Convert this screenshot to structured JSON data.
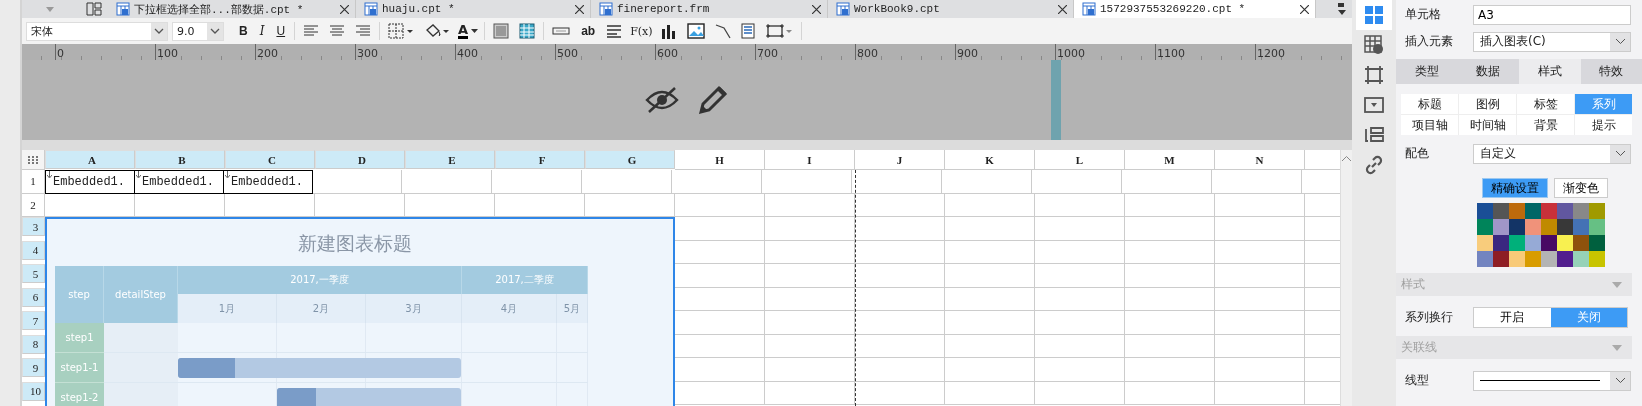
{
  "tabs": [
    {
      "label": "下拉框选择全部...部数据.cpt *",
      "selected": false
    },
    {
      "label": "huaju.cpt *",
      "selected": false
    },
    {
      "label": "finereport.frm",
      "selected": false
    },
    {
      "label": "WorkBook9.cpt",
      "selected": false
    },
    {
      "label": "1572937553269220.cpt *",
      "selected": true
    }
  ],
  "toolbar": {
    "font": "宋体",
    "size": "9.0",
    "style_buttons": [
      "B",
      "I",
      "U"
    ],
    "font_color": "A",
    "text_tools": [
      "ab",
      "F(x)"
    ]
  },
  "ruler": {
    "marks": [
      "0",
      "100",
      "200",
      "300",
      "400",
      "500",
      "600",
      "700",
      "800",
      "900",
      "1000",
      "1100",
      "1200"
    ]
  },
  "sheet": {
    "columns": [
      {
        "label": "A",
        "selected": true
      },
      {
        "label": "B",
        "selected": true
      },
      {
        "label": "C",
        "selected": true
      },
      {
        "label": "D",
        "selected": true
      },
      {
        "label": "E",
        "selected": true
      },
      {
        "label": "F",
        "selected": true
      },
      {
        "label": "G",
        "selected": true
      },
      {
        "label": "H",
        "selected": false
      },
      {
        "label": "I",
        "selected": false
      },
      {
        "label": "J",
        "selected": false
      },
      {
        "label": "K",
        "selected": false
      },
      {
        "label": "L",
        "selected": false
      },
      {
        "label": "M",
        "selected": false
      },
      {
        "label": "N",
        "selected": false
      }
    ],
    "rows": [
      {
        "label": "1",
        "selected": false,
        "cells": [
          "Embedded1.",
          "Embedded1.",
          "Embedded1."
        ]
      },
      {
        "label": "2",
        "selected": false,
        "cells": []
      },
      {
        "label": "3",
        "selected": true,
        "cells": []
      },
      {
        "label": "4",
        "selected": true,
        "cells": []
      },
      {
        "label": "5",
        "selected": true,
        "cells": []
      },
      {
        "label": "6",
        "selected": true,
        "cells": []
      },
      {
        "label": "7",
        "selected": true,
        "cells": []
      },
      {
        "label": "8",
        "selected": true,
        "cells": []
      },
      {
        "label": "9",
        "selected": true,
        "cells": []
      },
      {
        "label": "10",
        "selected": true,
        "cells": []
      }
    ]
  },
  "chart": {
    "title": "新建图表标题",
    "columns": [
      "step",
      "detailStep"
    ],
    "quarters": [
      {
        "label": "2017,一季度",
        "months": [
          "1月",
          "2月",
          "3月"
        ]
      },
      {
        "label": "2017,二季度",
        "months": [
          "4月",
          "5月"
        ]
      }
    ],
    "rows": [
      {
        "step": "step1",
        "months": [
          {
            "in_bar": false
          },
          {
            "in_bar": false
          },
          {
            "in_bar": false
          },
          {
            "in_bar": false
          },
          {
            "in_bar": false
          }
        ]
      },
      {
        "step": "step1-1",
        "months": [
          {
            "in_bar": true,
            "progress": {
              "level": 0.58
            }
          },
          {
            "in_bar": true
          },
          {
            "in_bar": true
          },
          {
            "in_bar": false
          },
          {
            "in_bar": false
          }
        ]
      },
      {
        "step": "step1-2",
        "months": [
          {
            "in_bar": false
          },
          {
            "in_bar": true,
            "progress": {
              "level": 0.44
            }
          },
          {
            "in_bar": true
          },
          {
            "in_bar": false
          },
          {
            "in_bar": false
          }
        ]
      }
    ]
  },
  "side_icons": [
    {
      "selected": true
    },
    {
      "selected": false
    },
    {
      "selected": false
    },
    {
      "selected": false
    },
    {
      "selected": false
    },
    {
      "selected": false
    }
  ],
  "panel": {
    "cell_label": "单元格",
    "cell_value": "A3",
    "insert_label": "插入元素",
    "insert_value": "插入图表(C)",
    "tabs": [
      {
        "label": "类型",
        "selected": false
      },
      {
        "label": "数据",
        "selected": false
      },
      {
        "label": "样式",
        "selected": true
      },
      {
        "label": "特效",
        "selected": false
      }
    ],
    "subtabs": [
      {
        "label": "标题",
        "selected": false
      },
      {
        "label": "图例",
        "selected": false
      },
      {
        "label": "标签",
        "selected": false
      },
      {
        "label": "系列",
        "selected": true
      },
      {
        "label": "项目轴",
        "selected": false
      },
      {
        "label": "时间轴",
        "selected": false
      },
      {
        "label": "背景",
        "selected": false
      },
      {
        "label": "提示",
        "selected": false
      }
    ],
    "scheme_label": "配色",
    "scheme_value": "自定义",
    "modes": [
      {
        "label": "精确设置",
        "selected": true
      },
      {
        "label": "渐变色",
        "selected": false
      }
    ],
    "palette": [
      {
        "color": "#1a4e96"
      },
      {
        "color": "#555555"
      },
      {
        "color": "#bd6a0c"
      },
      {
        "color": "#006666"
      },
      {
        "color": "#c8313a"
      },
      {
        "color": "#6157a0"
      },
      {
        "color": "#888888"
      },
      {
        "color": "#a09a00"
      },
      {
        "color": "#00845a"
      },
      {
        "color": "#a096c8"
      },
      {
        "color": "#133466"
      },
      {
        "color": "#f0927a"
      },
      {
        "color": "#c08a00"
      },
      {
        "color": "#383838"
      },
      {
        "color": "#4472b5"
      },
      {
        "color": "#66c084"
      },
      {
        "color": "#f8cc7c"
      },
      {
        "color": "#3a2880"
      },
      {
        "color": "#00b07a"
      },
      {
        "color": "#96aad6"
      },
      {
        "color": "#480a64"
      },
      {
        "color": "#f8f050"
      },
      {
        "color": "#8e520c"
      },
      {
        "color": "#00603e"
      },
      {
        "color": "#7384c0"
      },
      {
        "color": "#8e1e24"
      },
      {
        "color": "#f8ca78"
      },
      {
        "color": "#d89c00"
      },
      {
        "color": "#b4b4b4"
      },
      {
        "color": "#521e8e"
      },
      {
        "color": "#96d2b8"
      },
      {
        "color": "#c8c400"
      }
    ],
    "style_section": "样式",
    "wrap_label": "系列换行",
    "wrap_options": [
      {
        "label": "开启",
        "selected": false
      },
      {
        "label": "关闭",
        "selected": true
      }
    ],
    "link_section": "关联线",
    "line_label": "线型"
  }
}
